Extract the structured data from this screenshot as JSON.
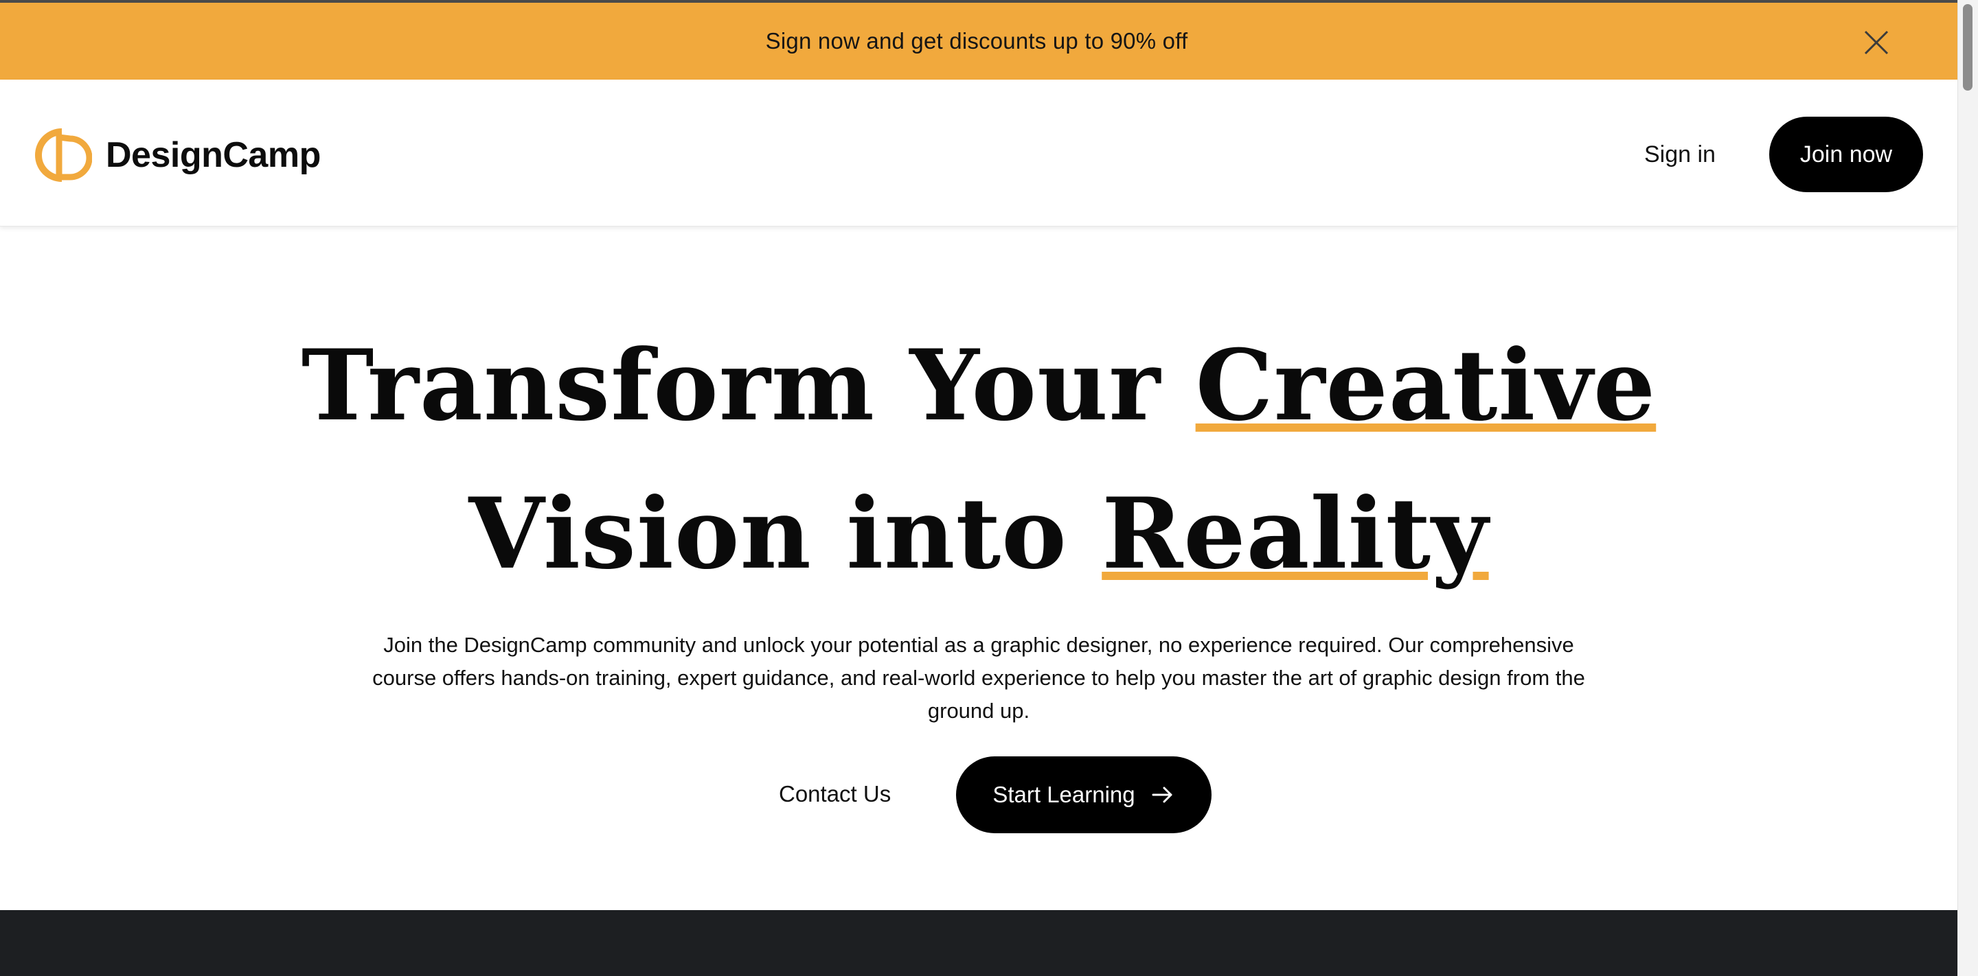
{
  "announcement": {
    "text": "Sign now and get discounts up to 90% off",
    "close_icon": "close-icon"
  },
  "header": {
    "brand": "DesignCamp",
    "logo_icon": "designcamp-logo-icon",
    "signin_label": "Sign in",
    "join_label": "Join now"
  },
  "hero": {
    "title_part1": "Transform Your ",
    "title_highlight1": "Creative",
    "title_part2": "Vision into ",
    "title_highlight2": "Reality",
    "description": "Join the DesignCamp community and unlock your potential as a graphic designer, no experience required. Our comprehensive course offers hands-on training, expert guidance, and real-world experience to help you master the art of graphic design from the ground up.",
    "contact_label": "Contact Us",
    "start_label": "Start Learning",
    "start_icon": "arrow-right-icon"
  },
  "colors": {
    "accent": "#f1a93d",
    "primary_button": "#000000",
    "dark_section": "#1d1f22"
  }
}
